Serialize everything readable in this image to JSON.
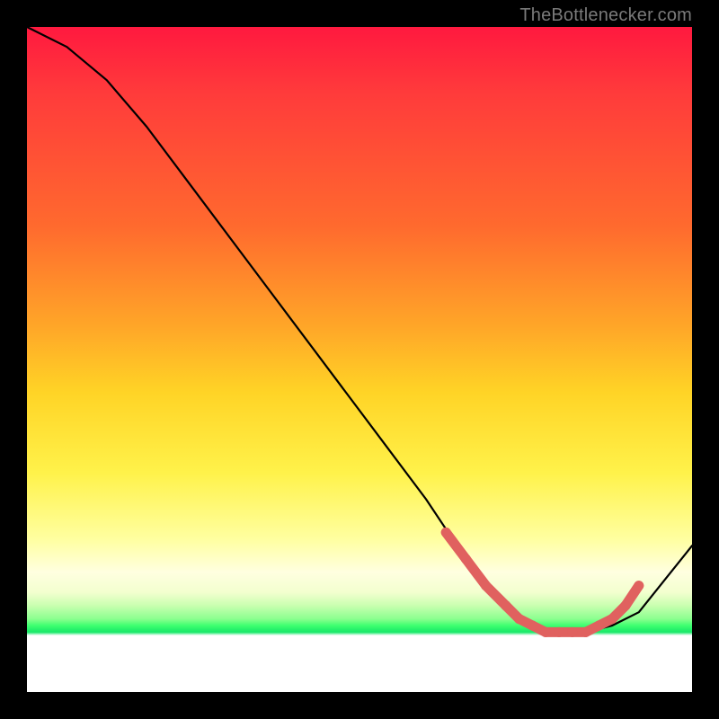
{
  "watermark": "TheBottlenecker.com",
  "colors": {
    "marker": "#e0615f",
    "curve": "#000000"
  },
  "chart_data": {
    "type": "line",
    "title": "",
    "xlabel": "",
    "ylabel": "",
    "xlim": [
      0,
      100
    ],
    "ylim": [
      0,
      100
    ],
    "series": [
      {
        "name": "curve",
        "x": [
          0,
          6,
          12,
          18,
          24,
          30,
          36,
          42,
          48,
          54,
          60,
          64,
          68,
          72,
          76,
          80,
          84,
          88,
          92,
          96,
          100
        ],
        "y": [
          100,
          97,
          92,
          85,
          77,
          69,
          61,
          53,
          45,
          37,
          29,
          23,
          18,
          13,
          10,
          9,
          9,
          10,
          12,
          17,
          22
        ]
      }
    ],
    "markers": {
      "name": "highlighted-points",
      "x": [
        63,
        66,
        69,
        72,
        74,
        76,
        78,
        80,
        82,
        84,
        86,
        88,
        90,
        92
      ],
      "y": [
        24,
        20,
        16,
        13,
        11,
        10,
        9,
        9,
        9,
        9,
        10,
        11,
        13,
        16
      ]
    }
  }
}
